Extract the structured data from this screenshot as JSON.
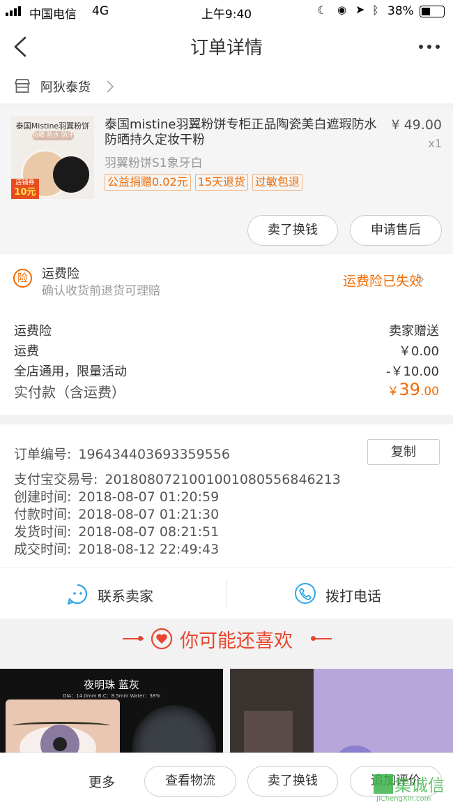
{
  "status_bar": {
    "carrier": "中国电信",
    "network": "4G",
    "time": "上午9:40",
    "battery": "38%"
  },
  "nav": {
    "title": "订单详情"
  },
  "shop": {
    "name": "阿狄泰货"
  },
  "product": {
    "thumb_top": "泰国Mistine羽翼粉饼",
    "thumb_sub": "防晒 防水 防汗",
    "thumb_badge": "店铺券",
    "thumb_badge_value": "10元",
    "title": "泰国mistine羽翼粉饼专柜正品陶瓷美白遮瑕防水防晒持久定妆干粉",
    "price": "¥ 49.00",
    "qty": "x1",
    "sku": "羽翼粉饼S1象牙白",
    "tags": [
      "公益捐赠0.02元",
      "15天退货",
      "过敏包退"
    ],
    "btn_sell": "卖了换钱",
    "btn_aftersale": "申请售后"
  },
  "insurance": {
    "icon_char": "险",
    "title": "运费险",
    "subtitle": "确认收货前退货可理赔",
    "status": "运费险已失效"
  },
  "fees": {
    "rows": [
      {
        "label": "运费险",
        "value": "卖家赠送"
      },
      {
        "label": "运费",
        "value": "￥0.00"
      },
      {
        "label": "全店通用，限量活动",
        "value": "-￥10.00"
      }
    ],
    "total_label": "实付款（含运费）",
    "total_symbol": "￥",
    "total_int": "39",
    "total_dec": ".00"
  },
  "order_info": {
    "order_no_label": "订单编号:",
    "order_no": "196434403693359556",
    "copy_btn": "复制",
    "alipay_label": "支付宝交易号:",
    "alipay_no": "2018080721001001080556846213",
    "created_label": "创建时间:",
    "created": "2018-08-07 01:20:59",
    "paid_label": "付款时间:",
    "paid": "2018-08-07 01:21:30",
    "shipped_label": "发货时间:",
    "shipped": "2018-08-07 08:21:51",
    "done_label": "成交时间:",
    "done": "2018-08-12 22:49:43"
  },
  "contact": {
    "seller": "联系卖家",
    "phone": "拨打电话"
  },
  "recommend": {
    "title": "你可能还喜欢",
    "img1_caption": "夜明珠 蓝灰",
    "img1_spec": "DIA：14.0mm  B.C：8.5mm  Water：38%"
  },
  "bottom": {
    "more": "更多",
    "logistics": "查看物流",
    "sell": "卖了换钱",
    "review": "追加评价",
    "watermark": "集诚信",
    "watermark_url": "JiChengXin.com"
  },
  "colors": {
    "accent": "#f06a00",
    "icon_blue": "#2fa6e6",
    "heart": "#e8462f"
  }
}
